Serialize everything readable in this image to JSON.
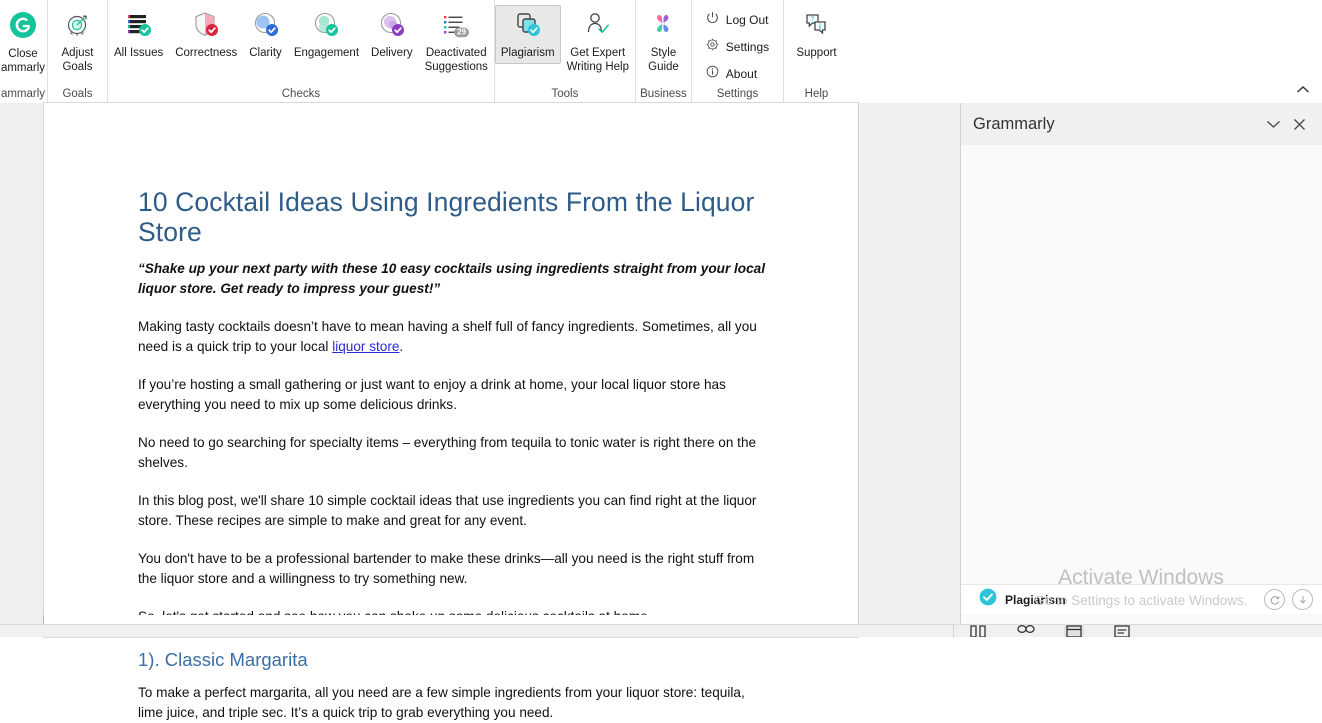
{
  "ribbon": {
    "groups": [
      {
        "name": "grammarly",
        "label": "ammarly",
        "items": [
          {
            "label": "Close\nammarly",
            "icon": "grammarly-logo-icon",
            "selected": false
          }
        ]
      },
      {
        "name": "goals",
        "label": "Goals",
        "items": [
          {
            "label": "Adjust\nGoals",
            "icon": "target-goal-icon",
            "selected": false
          }
        ]
      },
      {
        "name": "checks",
        "label": "Checks",
        "items": [
          {
            "label": "All Issues",
            "icon": "all-issues-icon",
            "selected": false
          },
          {
            "label": "Correctness",
            "icon": "correctness-shield-icon",
            "selected": false
          },
          {
            "label": "Clarity",
            "icon": "clarity-icon",
            "selected": false
          },
          {
            "label": "Engagement",
            "icon": "engagement-icon",
            "selected": false
          },
          {
            "label": "Delivery",
            "icon": "delivery-icon",
            "selected": false
          },
          {
            "label": "Deactivated\nSuggestions",
            "icon": "deactivated-suggestions-icon",
            "badge": "29",
            "selected": false
          }
        ]
      },
      {
        "name": "tools",
        "label": "Tools",
        "items": [
          {
            "label": "Plagiarism",
            "icon": "plagiarism-icon",
            "selected": true
          },
          {
            "label": "Get Expert\nWriting Help",
            "icon": "expert-writing-help-icon",
            "selected": false
          }
        ]
      },
      {
        "name": "business",
        "label": "Business",
        "items": [
          {
            "label": "Style\nGuide",
            "icon": "style-guide-pinwheel-icon",
            "selected": false
          }
        ]
      },
      {
        "name": "settings",
        "label": "Settings",
        "items": [
          {
            "label": "Log Out",
            "icon": "power-icon"
          },
          {
            "label": "Settings",
            "icon": "gear-icon"
          },
          {
            "label": "About",
            "icon": "info-icon"
          }
        ]
      },
      {
        "name": "help",
        "label": "Help",
        "items": [
          {
            "label": "Support",
            "icon": "support-chat-icon",
            "selected": false
          }
        ]
      }
    ],
    "collapse_icon": "chevron-up-icon"
  },
  "document": {
    "title": "10 Cocktail Ideas Using Ingredients From the Liquor Store",
    "lede": "“Shake up your next party with these 10 easy cocktails using ingredients straight from your local liquor store. Get ready to impress your guest!”",
    "paragraph1_before_link": "Making tasty cocktails doesn’t have to mean having a shelf full of fancy ingredients. Sometimes, all you need is a quick trip to your local ",
    "paragraph1_link": "liquor store",
    "paragraph1_after_link": ".",
    "paragraph2": "If you’re hosting a small gathering or just want to enjoy a drink at home, your local liquor store has everything you need to mix up some delicious drinks.",
    "paragraph3": "No need to go searching for specialty items – everything from tequila to tonic water is right there on the shelves.",
    "paragraph4": "In this blog post, we'll share 10 simple cocktail ideas that use ingredients you can find right at the liquor store. These recipes are simple to make and great for any event.",
    "paragraph5": "You don't have to be a professional bartender to make these drinks—all you need is the right stuff from the liquor store and a willingness to try something new.",
    "paragraph6": "So, let's get started and see how you can shake up some delicious cocktails at home.",
    "heading2": "1). Classic Margarita",
    "paragraph7": "To make a perfect margarita, all you need are a few simple ingredients from your liquor store: tequila, lime juice, and triple sec. It’s a quick trip to grab everything you need."
  },
  "grammarly_pane": {
    "title": "Grammarly",
    "collapse_icon": "chevron-down-icon",
    "close_icon": "close-icon",
    "status_label": "Plagiarism",
    "status_icon": "teal-check-icon",
    "refresh_icon": "refresh-icon",
    "download_icon": "download-icon"
  },
  "watermark": {
    "line1": "Activate Windows",
    "line2": "Go to Settings to activate Windows."
  },
  "statusbar": {
    "view_icons": [
      "read-mode-icon",
      "print-layout-icon",
      "web-layout-icon",
      "focus-icon"
    ]
  },
  "colors": {
    "grammarly_green": "#15c39a",
    "doc_heading_blue": "#2e5c8a",
    "link_blue": "#2b2bd6",
    "correctness_red": "#d7263d",
    "clarity_blue": "#2b6ed9",
    "engagement_green": "#15c39a",
    "delivery_purple": "#8b3ec4",
    "teal_check": "#2ec4d8"
  }
}
